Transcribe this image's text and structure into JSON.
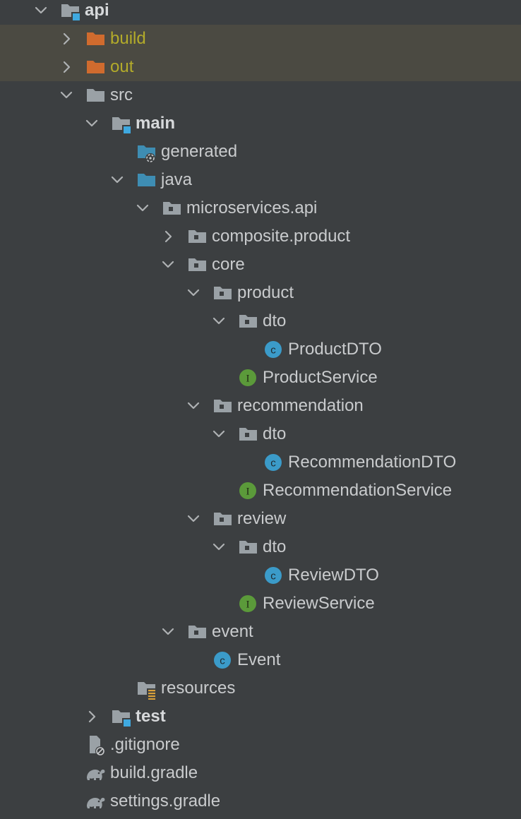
{
  "colors": {
    "background": "#3c3f41",
    "excluded_row": "#4b4a42",
    "text": "#c9cbcd",
    "excluded_text": "#b3ab2a",
    "folder_gray": "#9aa1a6",
    "folder_orange": "#d06b2e",
    "folder_blue": "#3e8db3",
    "module_badge": "#3fa9e0",
    "class_icon": "#3b9bc9",
    "interface_icon": "#5b9a3a"
  },
  "tree": [
    {
      "label": "api",
      "depth": 0,
      "arrow": "down",
      "icon": "module-folder-icon",
      "style": "bold"
    },
    {
      "label": "build",
      "depth": 1,
      "arrow": "right",
      "icon": "excluded-folder-icon",
      "style": "olive",
      "excluded": true
    },
    {
      "label": "out",
      "depth": 1,
      "arrow": "right",
      "icon": "excluded-folder-icon",
      "style": "olive",
      "excluded": true
    },
    {
      "label": "src",
      "depth": 1,
      "arrow": "down",
      "icon": "folder-icon"
    },
    {
      "label": "main",
      "depth": 2,
      "arrow": "down",
      "icon": "module-folder-icon",
      "style": "bold"
    },
    {
      "label": "generated",
      "depth": 3,
      "arrow": "none",
      "icon": "generated-sources-folder-icon"
    },
    {
      "label": "java",
      "depth": 3,
      "arrow": "down",
      "icon": "source-folder-icon"
    },
    {
      "label": "microservices.api",
      "depth": 4,
      "arrow": "down",
      "icon": "package-icon"
    },
    {
      "label": "composite.product",
      "depth": 5,
      "arrow": "right",
      "icon": "package-icon"
    },
    {
      "label": "core",
      "depth": 5,
      "arrow": "down",
      "icon": "package-icon"
    },
    {
      "label": "product",
      "depth": 6,
      "arrow": "down",
      "icon": "package-icon"
    },
    {
      "label": "dto",
      "depth": 7,
      "arrow": "down",
      "icon": "package-icon"
    },
    {
      "label": "ProductDTO",
      "depth": 8,
      "arrow": "none",
      "icon": "class-icon"
    },
    {
      "label": "ProductService",
      "depth": 7,
      "arrow": "none",
      "icon": "interface-icon"
    },
    {
      "label": "recommendation",
      "depth": 6,
      "arrow": "down",
      "icon": "package-icon"
    },
    {
      "label": "dto",
      "depth": 7,
      "arrow": "down",
      "icon": "package-icon"
    },
    {
      "label": "RecommendationDTO",
      "depth": 8,
      "arrow": "none",
      "icon": "class-icon"
    },
    {
      "label": "RecommendationService",
      "depth": 7,
      "arrow": "none",
      "icon": "interface-icon"
    },
    {
      "label": "review",
      "depth": 6,
      "arrow": "down",
      "icon": "package-icon"
    },
    {
      "label": "dto",
      "depth": 7,
      "arrow": "down",
      "icon": "package-icon"
    },
    {
      "label": "ReviewDTO",
      "depth": 8,
      "arrow": "none",
      "icon": "class-icon"
    },
    {
      "label": "ReviewService",
      "depth": 7,
      "arrow": "none",
      "icon": "interface-icon"
    },
    {
      "label": "event",
      "depth": 5,
      "arrow": "down",
      "icon": "package-icon"
    },
    {
      "label": "Event",
      "depth": 6,
      "arrow": "none",
      "icon": "class-icon"
    },
    {
      "label": "resources",
      "depth": 3,
      "arrow": "none",
      "icon": "resources-folder-icon"
    },
    {
      "label": "test",
      "depth": 2,
      "arrow": "right",
      "icon": "module-folder-icon",
      "style": "bold"
    },
    {
      "label": ".gitignore",
      "depth": 1,
      "arrow": "none",
      "icon": "gitignore-file-icon"
    },
    {
      "label": "build.gradle",
      "depth": 1,
      "arrow": "none",
      "icon": "gradle-file-icon"
    },
    {
      "label": "settings.gradle",
      "depth": 1,
      "arrow": "none",
      "icon": "gradle-file-icon"
    }
  ]
}
